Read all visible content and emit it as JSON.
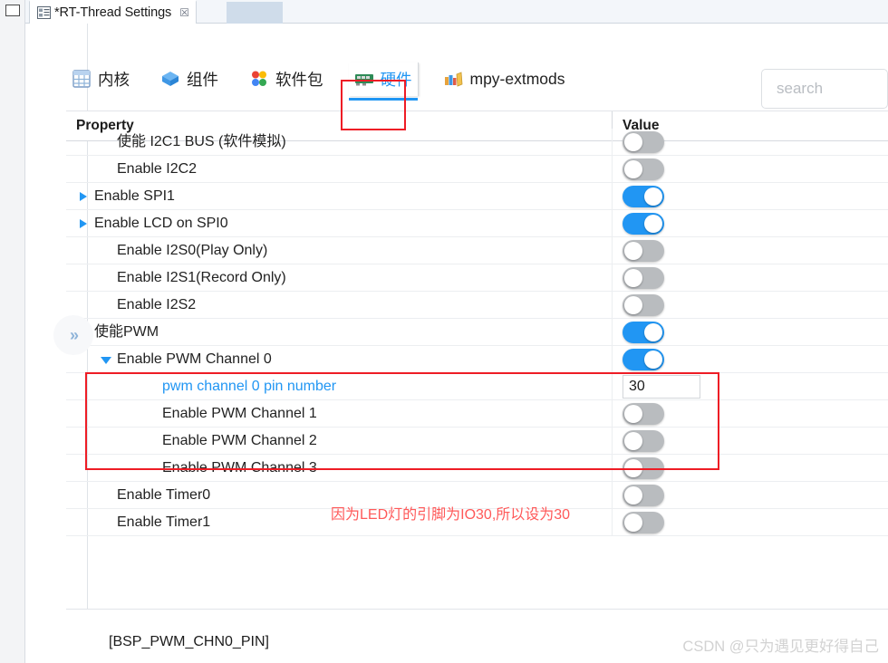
{
  "window": {
    "tab": {
      "title": "*RT-Thread Settings",
      "icon": "settings-list-icon",
      "close_glyph": "☒"
    },
    "minimize_glyph": "▭"
  },
  "nav": {
    "items": [
      {
        "label": "内核",
        "icon": "kernel-grid-icon",
        "selected": false
      },
      {
        "label": "组件",
        "icon": "components-box-icon",
        "selected": false
      },
      {
        "label": "软件包",
        "icon": "packages-quadrant-icon",
        "selected": false
      },
      {
        "label": "硬件",
        "icon": "hardware-board-icon",
        "selected": true
      },
      {
        "label": "mpy-extmods",
        "icon": "books-icon",
        "selected": false
      }
    ]
  },
  "search": {
    "placeholder": "search",
    "value": ""
  },
  "table": {
    "headers": {
      "property": "Property",
      "value": "Value"
    },
    "rows": [
      {
        "label": "使能 I2C1 BUS (软件模拟)",
        "indent": 1,
        "tri": "none",
        "value_type": "toggle",
        "toggle": "off",
        "clipped_top": true
      },
      {
        "label": "Enable I2C2",
        "indent": 1,
        "tri": "none",
        "value_type": "toggle",
        "toggle": "off"
      },
      {
        "label": "Enable SPI1",
        "indent": 0,
        "tri": "closed",
        "value_type": "toggle",
        "toggle": "on"
      },
      {
        "label": "Enable LCD on SPI0",
        "indent": 0,
        "tri": "closed",
        "value_type": "toggle",
        "toggle": "on"
      },
      {
        "label": "Enable I2S0(Play Only)",
        "indent": 1,
        "tri": "none",
        "value_type": "toggle",
        "toggle": "off"
      },
      {
        "label": "Enable I2S1(Record Only)",
        "indent": 1,
        "tri": "none",
        "value_type": "toggle",
        "toggle": "off"
      },
      {
        "label": "Enable I2S2",
        "indent": 1,
        "tri": "none",
        "value_type": "toggle",
        "toggle": "off"
      },
      {
        "label": "使能PWM",
        "indent": 0,
        "tri": "open",
        "value_type": "toggle",
        "toggle": "on"
      },
      {
        "label": "Enable PWM Channel 0",
        "indent": 1,
        "tri": "open",
        "value_type": "toggle",
        "toggle": "on"
      },
      {
        "label": "pwm channel 0 pin number",
        "indent": 3,
        "tri": "none",
        "value_type": "input",
        "input_value": "30",
        "link": true
      },
      {
        "label": "Enable PWM Channel 1",
        "indent": 3,
        "tri": "none",
        "value_type": "toggle",
        "toggle": "off"
      },
      {
        "label": "Enable PWM Channel 2",
        "indent": 3,
        "tri": "none",
        "value_type": "toggle",
        "toggle": "off"
      },
      {
        "label": "Enable PWM Channel 3",
        "indent": 3,
        "tri": "none",
        "value_type": "toggle",
        "toggle": "off"
      },
      {
        "label": "Enable Timer0",
        "indent": 1,
        "tri": "none",
        "value_type": "toggle",
        "toggle": "off"
      },
      {
        "label": "Enable Timer1",
        "indent": 1,
        "tri": "none",
        "value_type": "toggle",
        "toggle": "off",
        "clipped_bottom": true
      }
    ]
  },
  "annotations": {
    "pwm_note": "因为LED灯的引脚为IO30,所以设为30",
    "box_color": "#ee1c25",
    "note_color": "#ff5959"
  },
  "footer": {
    "symbol": "[BSP_PWM_CHN0_PIN]"
  },
  "sidebar": {
    "restore_glyph": "»"
  },
  "watermark": {
    "text": "CSDN @只为遇见更好得自己"
  },
  "colors": {
    "accent_blue": "#2196f3",
    "toggle_off": "#b9bcbf",
    "annotation_red": "#ee1c25"
  }
}
